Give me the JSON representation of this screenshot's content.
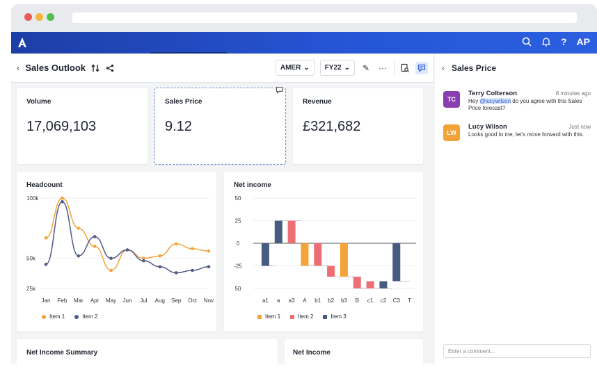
{
  "header": {
    "account": "AP"
  },
  "toolbar": {
    "title": "Sales Outlook",
    "region": "AMER",
    "year": "FY22",
    "more": "···"
  },
  "kpis": [
    {
      "label": "Volume",
      "value": "17,069,103"
    },
    {
      "label": "Sales Price",
      "value": "9.12"
    },
    {
      "label": "Revenue",
      "value": "£321,682"
    }
  ],
  "headcount": {
    "title": "Headcount",
    "chart_data": {
      "type": "line",
      "title": "Headcount",
      "categories": [
        "Jan",
        "Feb",
        "Mar",
        "Apr",
        "May",
        "Jun",
        "Jul",
        "Aug",
        "Sep",
        "Oct",
        "Nov"
      ],
      "y_ticks": [
        "100k",
        "50k",
        "25k"
      ],
      "ylim": [
        25,
        100
      ],
      "series": [
        {
          "name": "Item 1",
          "color": "#f2a33a",
          "values": [
            67,
            100,
            75,
            60,
            40,
            57,
            50,
            52,
            62,
            58,
            56
          ]
        },
        {
          "name": "Item 2",
          "color": "#4f5a86",
          "values": [
            45,
            97,
            52,
            68,
            50,
            57,
            48,
            43,
            38,
            40,
            43
          ]
        }
      ]
    }
  },
  "netincome": {
    "title": "Net income",
    "chart_data": {
      "type": "bar",
      "title": "Net income",
      "categories": [
        "a1",
        "a",
        "a3",
        "A",
        "b1",
        "b2",
        "b3",
        "B",
        "c1",
        "c2",
        "C3",
        "T"
      ],
      "y_ticks": [
        "50",
        "25",
        "0",
        "-25",
        "50"
      ],
      "ylim": [
        -50,
        50
      ],
      "series": [
        {
          "name": "Item 1",
          "color": "#f2a33a"
        },
        {
          "name": "Item 2",
          "color": "#ee6f73"
        },
        {
          "name": "Item 3",
          "color": "#465b80"
        }
      ],
      "bars": [
        {
          "cat": "a1",
          "from": 0,
          "to": -25,
          "series": 2
        },
        {
          "cat": "a",
          "from": 0,
          "to": 25,
          "series": 2
        },
        {
          "cat": "a3",
          "from": 0,
          "to": 25,
          "series": 1
        },
        {
          "cat": "A",
          "from": 0,
          "to": -25,
          "series": 0
        },
        {
          "cat": "b1",
          "from": 0,
          "to": -25,
          "series": 1
        },
        {
          "cat": "b2",
          "from": -25,
          "to": -37,
          "series": 1
        },
        {
          "cat": "b3",
          "from": 0,
          "to": -37,
          "series": 0
        },
        {
          "cat": "B",
          "from": -37,
          "to": -50,
          "series": 1
        },
        {
          "cat": "c1",
          "from": -42,
          "to": -50,
          "series": 1
        },
        {
          "cat": "c2",
          "from": -42,
          "to": -50,
          "series": 2
        },
        {
          "cat": "C3",
          "from": 0,
          "to": -42,
          "series": 2
        }
      ]
    }
  },
  "bottom": [
    {
      "label": "Net Income Summary"
    },
    {
      "label": "Net Income"
    }
  ],
  "panel": {
    "title": "Sales Price",
    "comments": [
      {
        "initials": "TC",
        "name": "Terry Colterson",
        "time": "8 minutes ago",
        "pre": "Hey ",
        "mention": "@lucywilson",
        "post": " do you agree with this Sales Price forecast?",
        "color": "#8a3fb0"
      },
      {
        "initials": "LW",
        "name": "Lucy Wilson",
        "time": "Just now",
        "pre": "Looks good to me, let's move forward with this.",
        "mention": "",
        "post": "",
        "color": "#f2a33a"
      }
    ],
    "input_placeholder": "Enter a comment..."
  }
}
